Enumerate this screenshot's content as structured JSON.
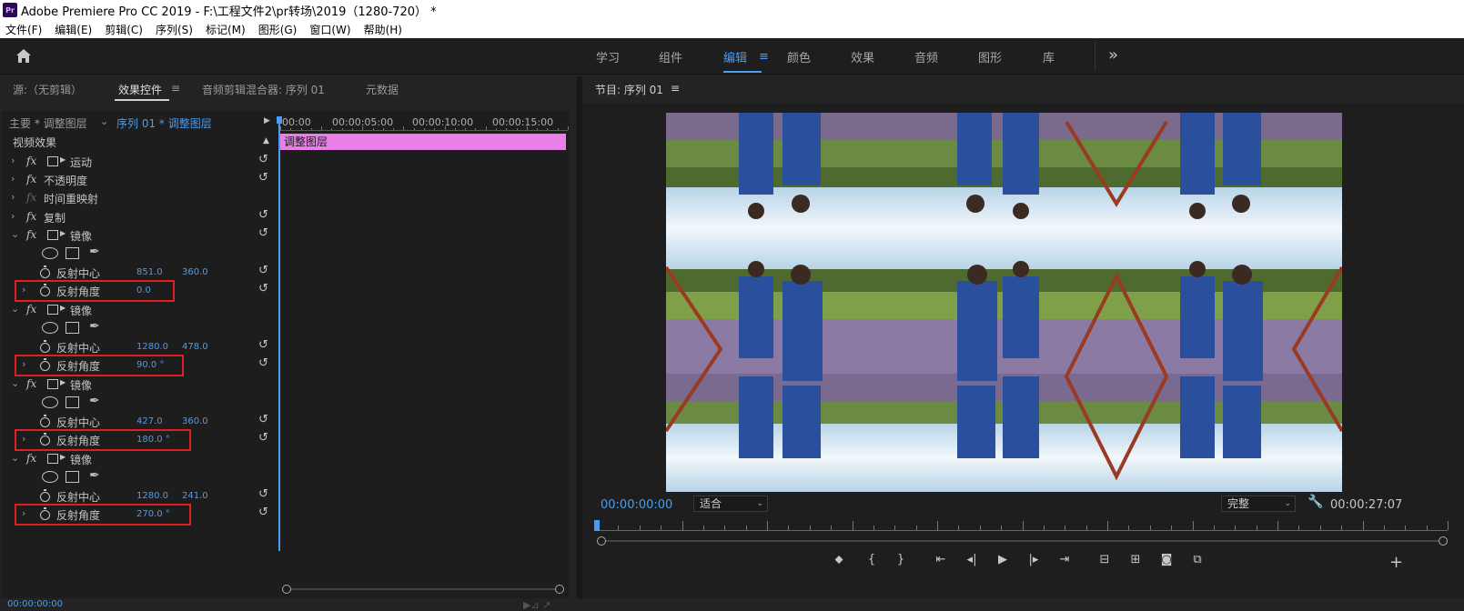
{
  "window": {
    "app_icon": "Pr",
    "title": "Adobe Premiere Pro CC 2019 - F:\\工程文件2\\pr转场\\2019（1280-720）  *"
  },
  "menu": [
    "文件(F)",
    "编辑(E)",
    "剪辑(C)",
    "序列(S)",
    "标记(M)",
    "图形(G)",
    "窗口(W)",
    "帮助(H)"
  ],
  "workspaces": {
    "tabs": [
      "学习",
      "组件",
      "编辑",
      "颜色",
      "效果",
      "音频",
      "图形",
      "库"
    ],
    "active": "编辑",
    "menu_icon": "≡",
    "more_icon": "»"
  },
  "left_tabs": {
    "source": "源:（无剪辑）",
    "effect_controls": "效果控件",
    "menu_icon": "≡",
    "audio_mixer": "音频剪辑混合器: 序列 01",
    "metadata": "元数据"
  },
  "effect_controls": {
    "master": "主要 * 调整图层",
    "sequence": "序列 01 * 调整图层",
    "ruler": [
      "00:00",
      "00:00:05:00",
      "00:00:10:00",
      "00:00:15:00"
    ],
    "clip_name": "调整图层",
    "video_effects": "视频效果",
    "effects": {
      "motion": "运动",
      "opacity": "不透明度",
      "time_remap": "时间重映射",
      "copy": "复制",
      "mirror": "镜像"
    },
    "props": {
      "center": "反射中心",
      "angle": "反射角度"
    },
    "mirror1": {
      "center_x": "851.0",
      "center_y": "360.0",
      "angle": "0.0"
    },
    "mirror2": {
      "center_x": "1280.0",
      "center_y": "478.0",
      "angle": "90.0 °"
    },
    "mirror3": {
      "center_x": "427.0",
      "center_y": "360.0",
      "angle": "180.0 °"
    },
    "mirror4": {
      "center_x": "1280.0",
      "center_y": "241.0",
      "angle": "270.0 °"
    },
    "bottom_time": "00:00:00:00"
  },
  "program": {
    "title": "节目: 序列 01",
    "menu_icon": "≡",
    "timecode": "00:00:00:00",
    "fit": "适合",
    "quality": "完整",
    "duration": "00:00:27:07"
  },
  "colors": {
    "accent": "#4a9cf0",
    "clip": "#e880e8",
    "highlight_box": "#e02020"
  }
}
